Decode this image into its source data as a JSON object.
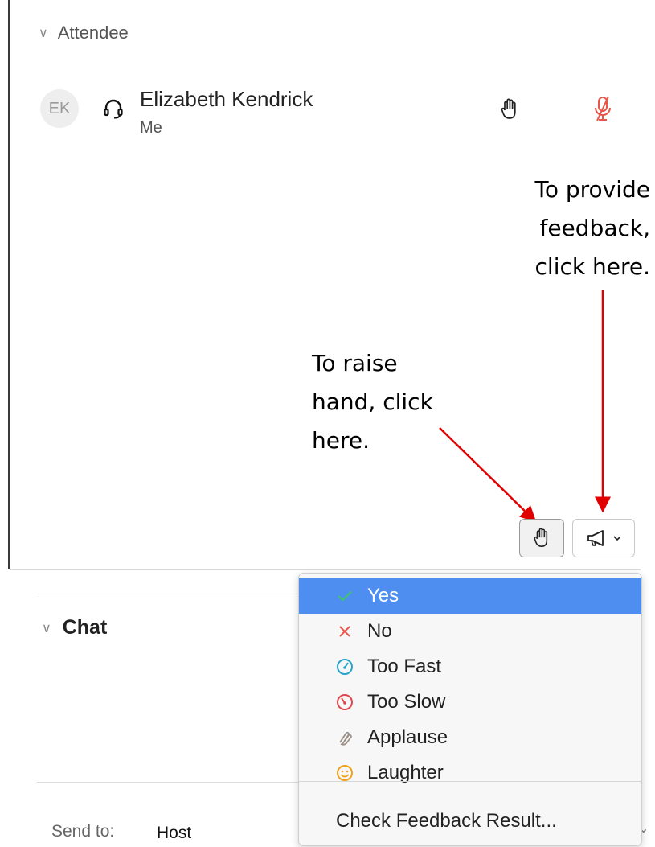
{
  "attendee_section": {
    "header": "Attendee"
  },
  "attendee": {
    "initials": "EK",
    "name": "Elizabeth Kendrick",
    "subtitle": "Me"
  },
  "annotations": {
    "feedback_lines": [
      "To provide",
      "feedback,",
      "click here."
    ],
    "raise_hand_lines": [
      "To raise",
      "hand, click",
      "here."
    ]
  },
  "chat_section": {
    "header": "Chat"
  },
  "send_to": {
    "label": "Send to:",
    "value": "Host"
  },
  "feedback_menu": {
    "items": [
      {
        "label": "Yes",
        "icon": "check-icon",
        "selected": true
      },
      {
        "label": "No",
        "icon": "x-icon",
        "selected": false
      },
      {
        "label": "Too Fast",
        "icon": "speedometer-fast-icon",
        "selected": false
      },
      {
        "label": "Too Slow",
        "icon": "speedometer-slow-icon",
        "selected": false
      },
      {
        "label": "Applause",
        "icon": "clapping-hands-icon",
        "selected": false
      },
      {
        "label": "Laughter",
        "icon": "smiley-icon",
        "selected": false
      }
    ],
    "footer_item": "Check Feedback Result..."
  },
  "colors": {
    "menu_selected": "#4e8ef0",
    "muted_red": "#e8564a",
    "arrow_red": "#e00000"
  }
}
